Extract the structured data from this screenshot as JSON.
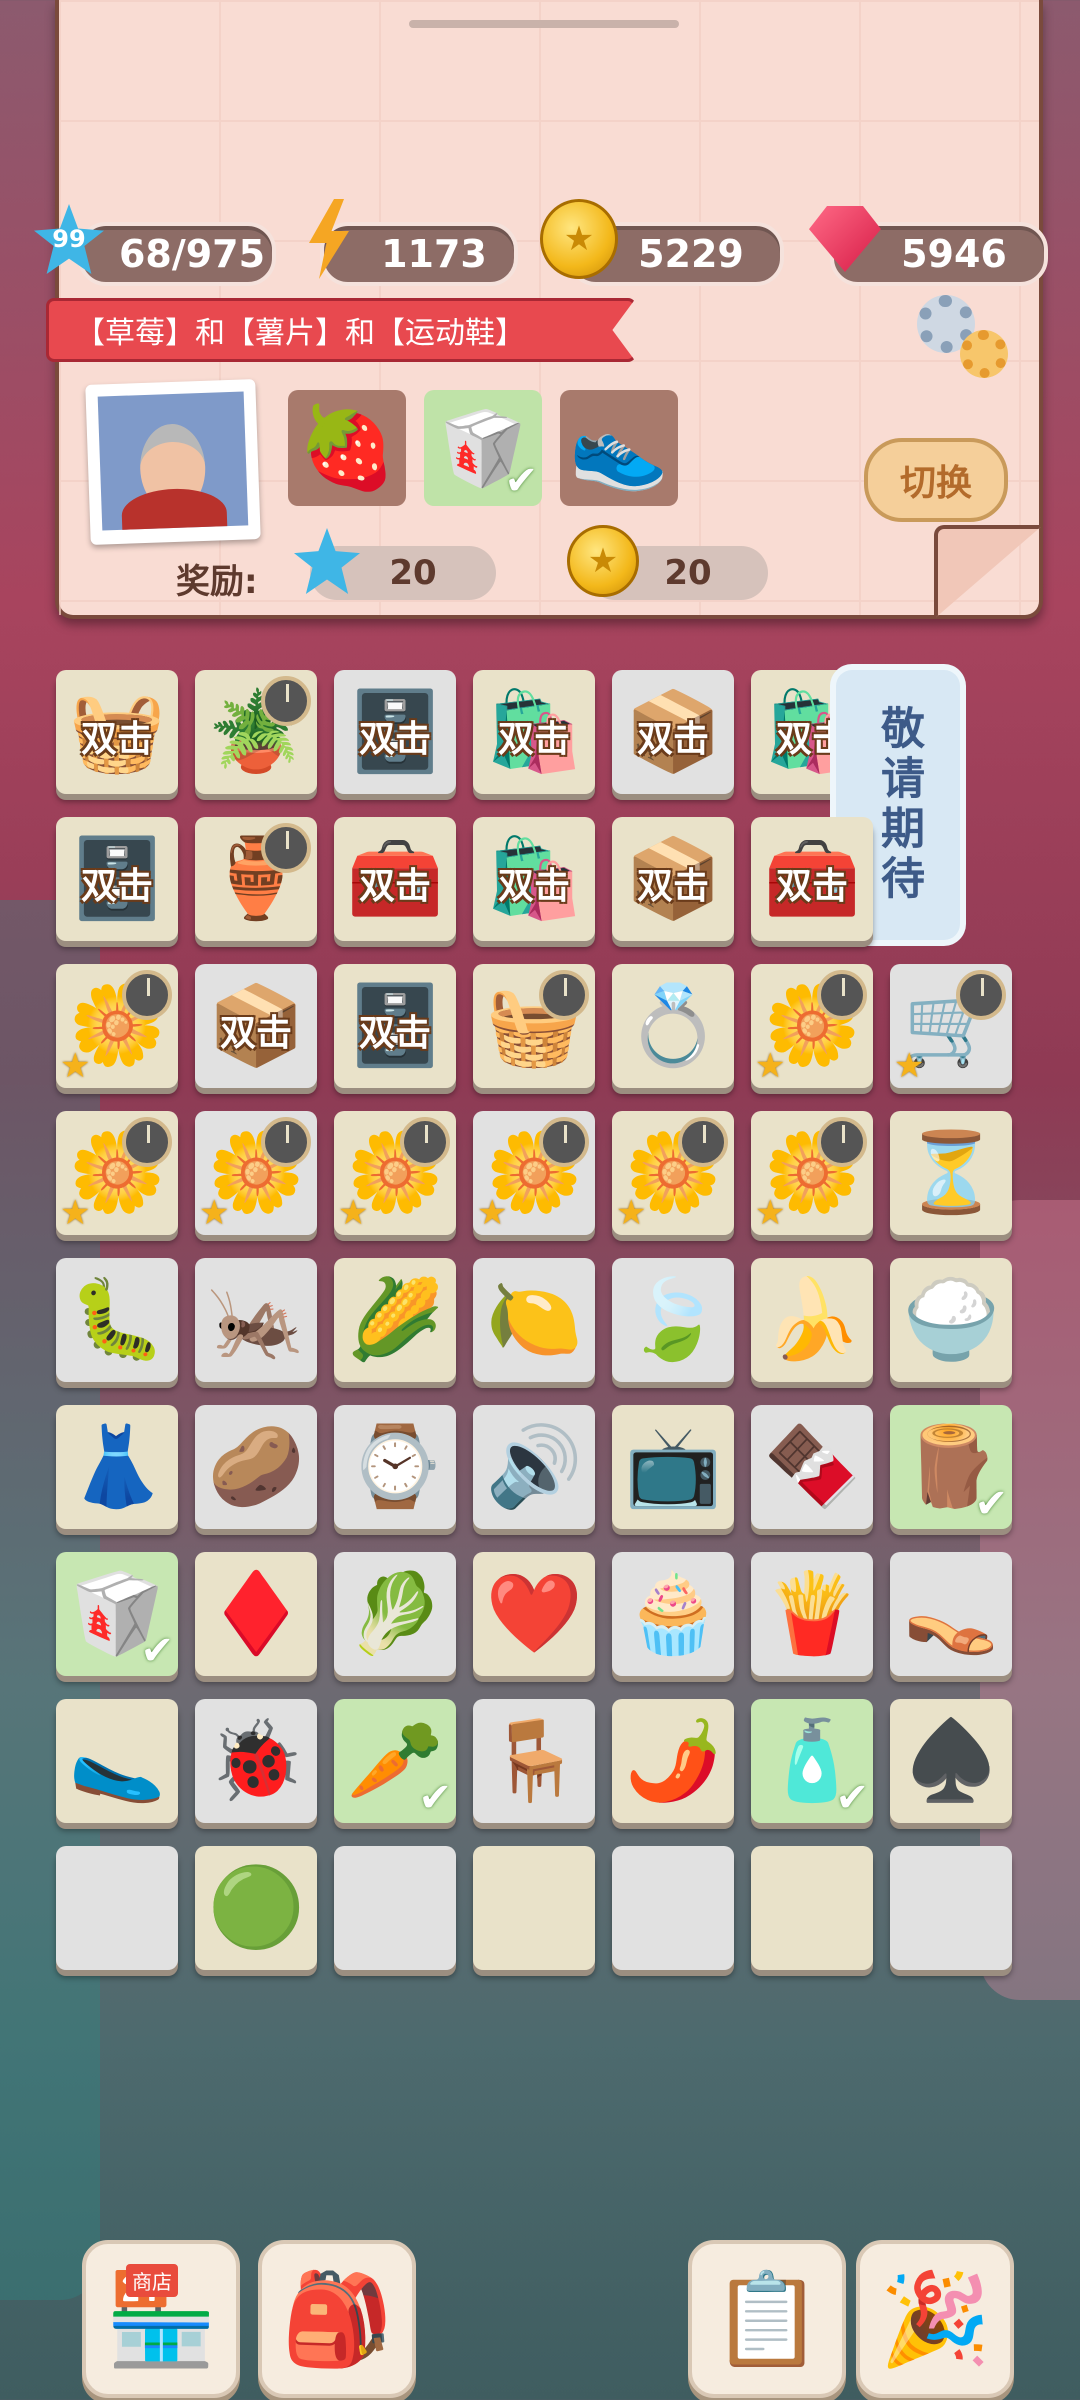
{
  "resources": {
    "level": "99",
    "xp": "68/975",
    "energy": "1173",
    "coins": "5229",
    "gems": "5946"
  },
  "order": {
    "title": "【草莓】和【薯片】和【运动鞋】",
    "items": [
      "strawberry",
      "chips",
      "sneakers"
    ],
    "switch_label": "切换",
    "reward_label": "奖励:",
    "reward_stars": "20",
    "reward_coins": "20"
  },
  "board": {
    "double_label": "双击",
    "coming_soon": "敬请期待"
  },
  "bottom_bar": {
    "shop_label": "商店"
  },
  "colors": {
    "accent_red": "#e8494f",
    "cell_cream": "#e9e2c9",
    "cell_green": "#c7e7b2"
  }
}
